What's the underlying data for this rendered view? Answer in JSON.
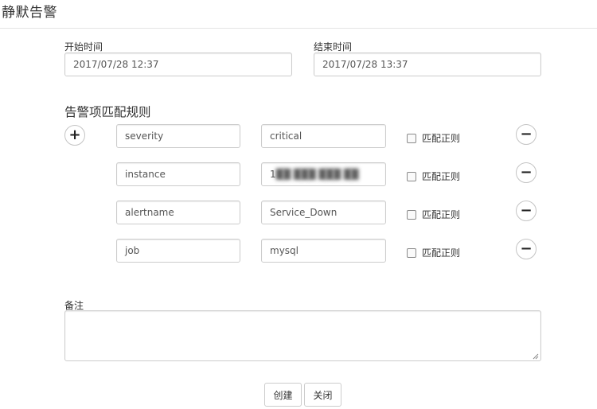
{
  "dialog": {
    "title": "静默告警"
  },
  "time": {
    "start_label": "开始时间",
    "start_value": "2017/07/28 12:37",
    "end_label": "结束时间",
    "end_value": "2017/07/28 13:37"
  },
  "rules": {
    "section_title": "告警项匹配规则",
    "add_symbol": "+",
    "remove_symbol": "−",
    "regex_label": "匹配正则",
    "items": [
      {
        "name": "severity",
        "value": "critical",
        "regex": false
      },
      {
        "name": "instance",
        "value": "1",
        "value_masked": "██ ███ ███ ██",
        "regex": false
      },
      {
        "name": "alertname",
        "value": "Service_Down",
        "regex": false
      },
      {
        "name": "job",
        "value": "mysql",
        "regex": false
      }
    ]
  },
  "note": {
    "label": "备注",
    "value": ""
  },
  "actions": {
    "create_label": "创建",
    "close_label": "关闭"
  }
}
